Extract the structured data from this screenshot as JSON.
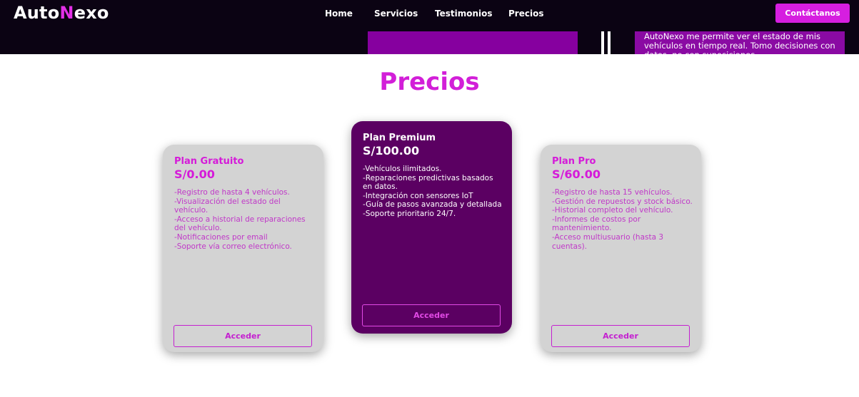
{
  "header": {
    "logo": {
      "part1": "Auto",
      "part2": "N",
      "part3": "exo"
    },
    "nav": [
      {
        "label": "Home"
      },
      {
        "label": "Servicios"
      },
      {
        "label": "Testimonios"
      },
      {
        "label": "Precios"
      }
    ],
    "contact_label": "Contáctanos"
  },
  "testimonial_peek": {
    "text": "AutoNexo me permite ver el estado de mis vehículos en tiempo real. Tomo decisiones con datos, no con suposiciones."
  },
  "pricing": {
    "title": "Precios",
    "plans": [
      {
        "name": "Plan Gratuito",
        "price": "S/0.00",
        "features": [
          "-Registro de hasta 4 vehículos.",
          "-Visualización del estado del vehículo.",
          "-Acceso a historial de reparaciones del vehículo.",
          "-Notificaciones por email",
          "-Soporte vía correo electrónico."
        ],
        "button": "Acceder"
      },
      {
        "name": "Plan Premium",
        "price": "S/100.00",
        "features": [
          "-Vehículos ilimitados.",
          "-Reparaciones predictivas basados en datos.",
          "-Integración con sensores IoT",
          "-Guía de pasos avanzada y detallada",
          "-Soporte prioritario 24/7."
        ],
        "button": "Acceder"
      },
      {
        "name": "Plan Pro",
        "price": "S/60.00",
        "features": [
          "-Registro de hasta 15 vehículos.",
          "-Gestión de repuestos y stock básico.",
          "-Historial completo del vehículo.",
          "-Informes de costos por mantenimiento.",
          "-Acceso multiusuario (hasta 3 cuentas)."
        ],
        "button": "Acceder"
      }
    ]
  },
  "colors": {
    "accent": "#d61ee0",
    "header_bg": "#0b0313",
    "premium_card": "#5b0062",
    "standard_card": "#d3d3d3"
  }
}
